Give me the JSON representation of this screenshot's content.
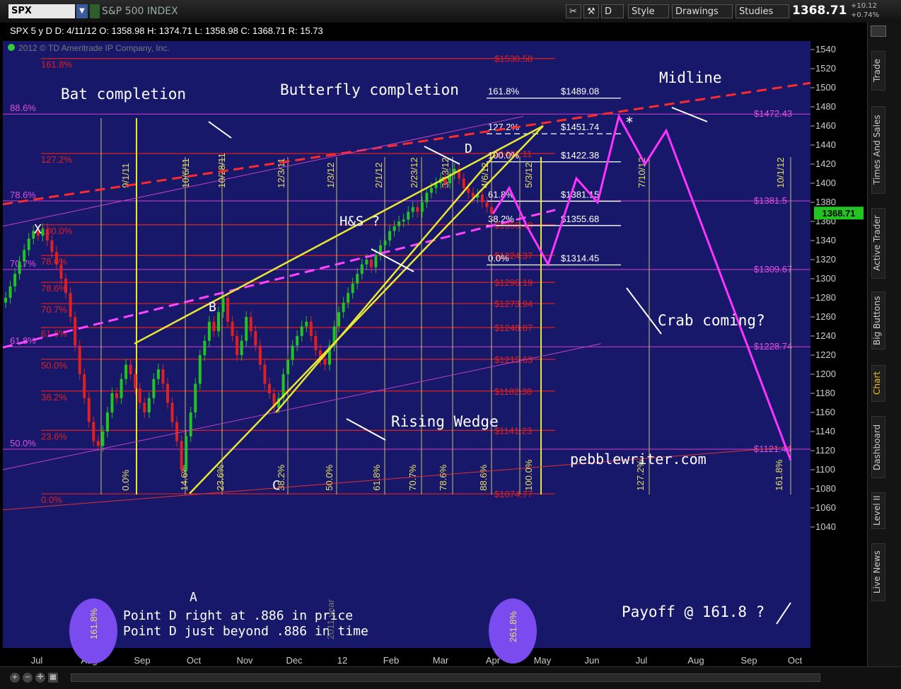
{
  "toolbar": {
    "symbol": "SPX",
    "symbol_name": "S&P 500 INDEX",
    "style_label": "Style",
    "drawings_label": "Drawings",
    "studies_label": "Studies",
    "last_price": "1368.71",
    "change_abs": "+10.12",
    "change_pct": "+0.74%",
    "d_label": "D"
  },
  "header": {
    "info_line": "SPX 5 y D  D: 4/11/12  O: 1358.98  H: 1374.71  L: 1358.98  C: 1368.71  R: 15.73",
    "copyright": "2012 © TD Ameritrade IP Company, Inc."
  },
  "sidebar": {
    "tabs": [
      "Trade",
      "Times And Sales",
      "Active Trader",
      "Big Buttons",
      "Chart",
      "Dashboard",
      "Level II",
      "Live News"
    ]
  },
  "price_tag": "1368.71",
  "chart_data": {
    "type": "candlestick",
    "title": "",
    "ylim": [
      1030,
      1550
    ],
    "y_ticks": [
      1040,
      1060,
      1080,
      1100,
      1120,
      1140,
      1160,
      1180,
      1200,
      1220,
      1240,
      1260,
      1280,
      1300,
      1320,
      1340,
      1360,
      1380,
      1400,
      1420,
      1440,
      1460,
      1480,
      1500,
      1520,
      1540
    ],
    "x_labels": [
      "Jul",
      "Aug",
      "Sep",
      "Oct",
      "Nov",
      "Dec",
      "12",
      "Feb",
      "Mar",
      "Apr",
      "May",
      "Jun",
      "Jul",
      "Aug",
      "Sep",
      "Oct"
    ],
    "x_label_positions": [
      52,
      126,
      201,
      274,
      346,
      416,
      484,
      553,
      623,
      697,
      767,
      837,
      907,
      984,
      1059,
      1124
    ],
    "candles_close": [
      1280,
      1292,
      1305,
      1318,
      1330,
      1342,
      1350,
      1345,
      1352,
      1340,
      1328,
      1315,
      1300,
      1285,
      1260,
      1230,
      1200,
      1175,
      1150,
      1130,
      1125,
      1140,
      1160,
      1180,
      1175,
      1195,
      1210,
      1200,
      1185,
      1170,
      1160,
      1175,
      1195,
      1205,
      1190,
      1170,
      1150,
      1130,
      1100,
      1135,
      1160,
      1190,
      1220,
      1235,
      1255,
      1245,
      1265,
      1280,
      1255,
      1240,
      1220,
      1235,
      1260,
      1245,
      1230,
      1210,
      1190,
      1180,
      1165,
      1175,
      1200,
      1215,
      1230,
      1240,
      1250,
      1255,
      1240,
      1225,
      1215,
      1210,
      1230,
      1250,
      1265,
      1275,
      1285,
      1295,
      1305,
      1315,
      1320,
      1312,
      1325,
      1335,
      1340,
      1350,
      1355,
      1360,
      1362,
      1370,
      1375,
      1370,
      1380,
      1390,
      1395,
      1400,
      1405,
      1400,
      1410,
      1415,
      1405,
      1395,
      1390,
      1385,
      1388,
      1380,
      1375,
      1368
    ],
    "fib_price_levels": [
      {
        "label": "161.8%",
        "price": "$1530.58",
        "value": 1530.58
      },
      {
        "label": "127.2%",
        "price": "$1431.11",
        "value": 1431.11
      },
      {
        "label": "100.0%",
        "price": "$1356.48",
        "value": 1356.48
      },
      {
        "label": "78.6%",
        "price": "$1324.37",
        "value": 1324.37
      },
      {
        "label": "78.6%",
        "price": "$1296.19",
        "value": 1296.19
      },
      {
        "label": "70.7%",
        "price": "$1273.94",
        "value": 1273.94
      },
      {
        "label": "61.8%",
        "price": "$1248.87",
        "value": 1248.87
      },
      {
        "label": "50.0%",
        "price": "$1215.63",
        "value": 1215.63
      },
      {
        "label": "38.2%",
        "price": "$1182.38",
        "value": 1182.38
      },
      {
        "label": "23.6%",
        "price": "$1141.23",
        "value": 1141.23
      },
      {
        "label": "0.0%",
        "price": "$1074.77",
        "value": 1074.77
      }
    ],
    "magenta_levels": [
      {
        "label": "88.6%",
        "price": "$1472.43",
        "value": 1472.43
      },
      {
        "label": "78.6%",
        "price": "$1381.5",
        "value": 1381.5
      },
      {
        "label": "70.7%",
        "price": "$1309.67",
        "value": 1309.67
      },
      {
        "label": "61.8%",
        "price": "$1228.74",
        "value": 1228.74
      },
      {
        "label": "50.0%",
        "price": "$1121.44",
        "value": 1121.44
      }
    ],
    "white_levels": [
      {
        "label": "161.8%",
        "price": "$1489.08",
        "value": 1489.08
      },
      {
        "label": "127.2%",
        "price": "$1451.74",
        "value": 1451.74
      },
      {
        "label": "100.0%",
        "price": "$1422.38",
        "value": 1422.38
      },
      {
        "label": "61.8%",
        "price": "$1381.15",
        "value": 1381.15
      },
      {
        "label": "38.2%",
        "price": "$1355.68",
        "value": 1355.68
      },
      {
        "label": "0.0%",
        "price": "$1314.45",
        "value": 1314.45
      }
    ],
    "time_fibs": [
      "0.0%",
      "14.6%",
      "23.6%",
      "38.2%",
      "50.0%",
      "61.8%",
      "70.7%",
      "78.6%",
      "88.6%",
      "100.0%",
      "127.2%",
      "161.8%"
    ],
    "date_labels": [
      "9/1/11",
      "10/6/11",
      "10/28/11",
      "12/3/11",
      "1/3/12",
      "2/1/12",
      "2/23/12",
      "3/13/12",
      "4/6/12",
      "5/3/12",
      "7/10/12",
      "10/1/12"
    ],
    "points": [
      "X",
      "A",
      "B",
      "C",
      "D"
    ],
    "projection_path": [
      1368,
      1395,
      1355,
      1315,
      1405,
      1380,
      1470,
      1420,
      1455,
      1110
    ],
    "annotations": {
      "bat": "Bat completion",
      "butterfly": "Butterfly completion",
      "midline": "Midline",
      "hs": "H&S ?",
      "crab": "Crab coming?",
      "wedge": "Rising Wedge",
      "site": "pebblewriter.com",
      "payoff": "Payoff @ 161.8 ?",
      "note1": "Point D right at .886 in price",
      "note2": "Point D just beyond .886 in time",
      "oval1": "161.8%",
      "oval2": "261.8%",
      "star": "*",
      "year": "2011 year"
    },
    "colors": {
      "background": "#18186b",
      "candle_up": "#22c422",
      "candle_down": "#e02020",
      "fib_red": "#e02020",
      "time_yellow": "#e8e830",
      "projection": "#ff33ff",
      "midline": "#ff2a2a"
    }
  }
}
